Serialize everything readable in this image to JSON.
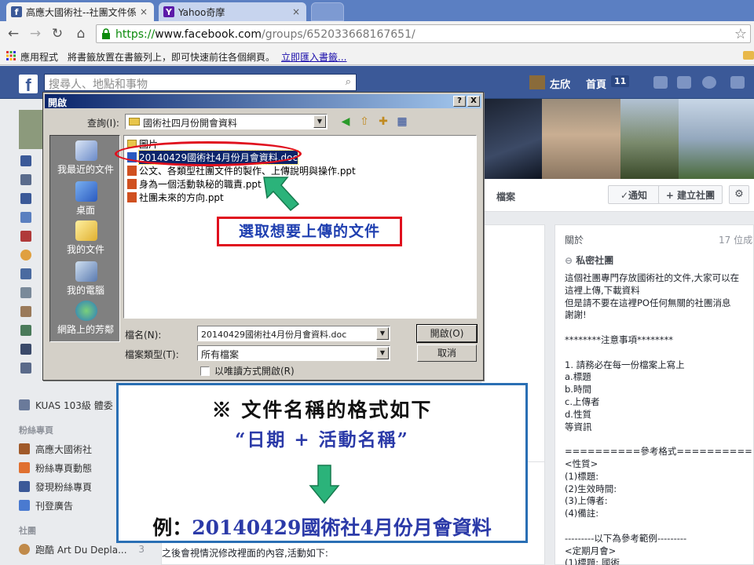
{
  "browser": {
    "tabs": [
      {
        "title": "高應大國術社--社團文件係",
        "favicon": "f"
      },
      {
        "title": "Yahoo奇摩",
        "favicon": "Y"
      },
      {
        "title": ""
      }
    ],
    "url_scheme": "https://",
    "url_host": "www.facebook.com",
    "url_path": "/groups/652033668167651/",
    "bookmarks": {
      "apps_label": "應用程式",
      "hint": "將書籤放置在書籤列上，即可快速前往各個網頁。",
      "import_link": "立即匯入書籤..."
    }
  },
  "facebook": {
    "search_placeholder": "搜尋人、地點和事物",
    "user_name": "左欣",
    "home_label": "首頁",
    "home_count": "11",
    "sidebar": {
      "fan_pages_heading": "粉絲專頁",
      "fan_pages": [
        "高應大國術社",
        "粉絲專頁動態",
        "發現粉絲專頁",
        "刊登廣告"
      ],
      "groups_heading": "社團",
      "group_item": "跑酷 Art Du Depla...",
      "group_item_count": "3",
      "kuas_item": "KUAS 103級 體委"
    },
    "group_nav": {
      "files_tab": "檔案",
      "notify_button": "✓通知",
      "create_group_button": "+ 建立社團",
      "settings_icon": "gear-icon"
    },
    "about": {
      "title": "關於",
      "members": "17 位成",
      "privacy": "私密社團",
      "text": "這個社團專門存放國術社的文件,大家可以在\n這裡上傳,下載資料\n但是請不要在這裡PO任何無關的社團消息\n謝謝!\n\n********注意事項********\n\n1. 請務必在每一份檔案上寫上\na.標題\nb.時間\nc.上傳者\nd.性質\n等資訊\n\n==========參考格式==========\n<性質>\n(1)標題:\n(2)生效時間:\n(3)上傳者:\n(4)備註:\n\n---------以下為參考範例---------\n<定期月會>\n(1)標題: 國術"
    },
    "post_text": "之後會視情況修改裡面的內容,活動如下:"
  },
  "dialog": {
    "title": "開啟",
    "help_button": "?",
    "close_button": "X",
    "look_in_label": "查詢(I):",
    "look_in_value": "國術社四月份開會資料",
    "places": [
      "我最近的文件",
      "桌面",
      "我的文件",
      "我的電腦",
      "網路上的芳鄰"
    ],
    "files": [
      {
        "name": "圖片",
        "type": "folder"
      },
      {
        "name": "20140429國術社4月份月會資料.doc",
        "type": "doc",
        "selected": true
      },
      {
        "name": "公文、各類型社團文件的製作、上傳說明與操作.ppt",
        "type": "ppt"
      },
      {
        "name": "身為一個活動執秘的職責.ppt",
        "type": "ppt"
      },
      {
        "name": "社團未來的方向.ppt",
        "type": "ppt"
      }
    ],
    "filename_label": "檔名(N):",
    "filename_value": "20140429國術社4月份月會資料.doc",
    "filetype_label": "檔案類型(T):",
    "filetype_value": "所有檔案",
    "open_button": "開啟(O)",
    "cancel_button": "取消",
    "readonly_label": "以唯讀方式開啟(R)"
  },
  "annotations": {
    "select_hint": "選取想要上傳的文件",
    "format_title": "※ 文件名稱的格式如下",
    "format_rule": "“日期 + 活動名稱”",
    "example_label": "例：",
    "example_value": "20140429國術社4月份月會資料"
  },
  "colors": {
    "facebook_blue": "#3b5998",
    "annotation_red": "#e0101e",
    "annotation_blue_text": "#2b3aa8",
    "arrow_green": "#2bb37a",
    "selection_navy": "#0a246a"
  }
}
